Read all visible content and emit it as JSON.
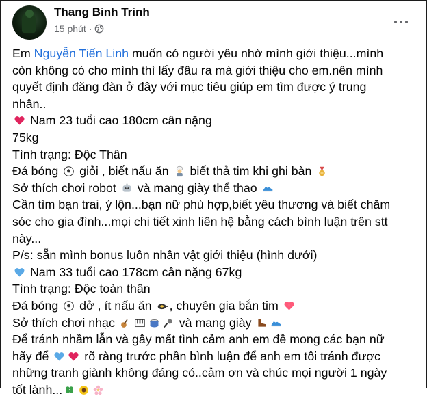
{
  "post": {
    "author": "Thang Binh Trinh",
    "time": "15 phút",
    "privacy": "globe-icon"
  },
  "content": {
    "l1_pre": "Em ",
    "mention": "Nguyễn Tiến Linh",
    "l1_post": " muốn có người yêu nhờ mình giới thiệu...mình",
    "l2": "còn không có cho mình thì lấy đâu ra mà giới thiệu cho em.nên mình",
    "l3": "quyết định đăng đàn ở đây với mục tiêu giúp em tìm được ý trung",
    "l4": "nhân..",
    "l5": " Nam 23 tuổi cao 180cm cân nặng",
    "l6": "75kg",
    "l7": "Tình trạng: Độc Thân",
    "l8a": "Đá bóng ",
    "l8b": " giỏi , biết nấu ăn ",
    "l8c": " biết thả tim khi ghi bàn ",
    "l9a": "Sở thích chơi robot ",
    "l9b": " và mang giày thể thao ",
    "l10": "Cần tìm bạn trai, ý lộn...bạn nữ phù hợp,biết yêu thương và biết chăm",
    "l11": "sóc cho gia đình...mọi chi tiết xinh liên hệ bằng cách bình luận trên stt",
    "l12": "này...",
    "l13": "P/s: sẵn mình bonus luôn nhân vật giới thiệu  (hình dưới)",
    "l14": " Nam 33 tuổi cao 178cm cân nặng 67kg",
    "l15": "Tình trạng: Độc toàn thân",
    "l16a": "Đá bóng ",
    "l16b": " dở , ít nấu ăn ",
    "l16c": ", chuyên gia bắn tim ",
    "l17a": "Sở thích chơi nhạc ",
    "l17b": " và mang giày ",
    "l18": "Để tránh nhầm lẫn và gây mất tình cảm anh em đề mong các bạn nữ",
    "l19a": "hãy để ",
    "l19b": " rõ ràng trước phần bình luận để anh em tôi tránh được",
    "l20": "những tranh giành không đáng có..cảm ơn và chúc mọi người 1 ngày",
    "l21": "tốt lành..."
  },
  "icons": {
    "heart_red": "#e0245e",
    "heart_blue": "#5aa9e6",
    "accent_link": "#216fdb"
  }
}
